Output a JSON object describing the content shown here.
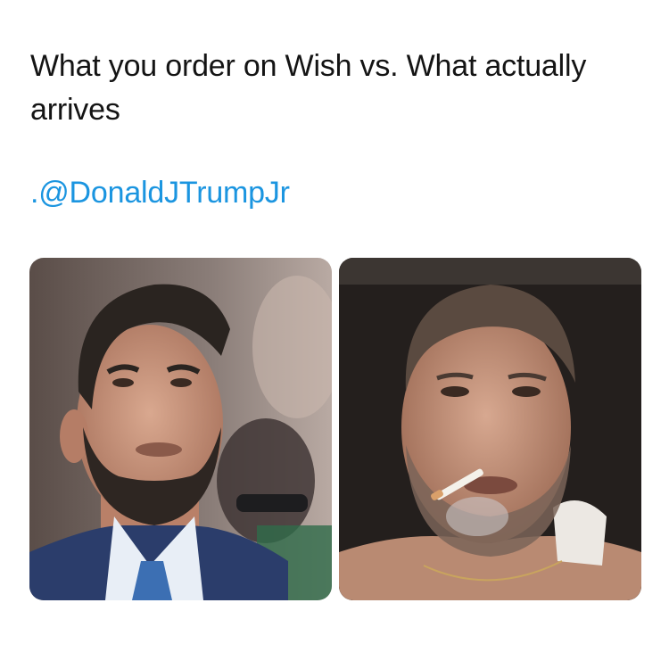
{
  "post": {
    "text": "What you order on Wish vs. What actually arrives",
    "mention": ".@DonaldJTrumpJr"
  },
  "images": [
    {
      "name": "left-photo",
      "description": "portrait"
    },
    {
      "name": "right-photo",
      "description": "selfie"
    }
  ],
  "colors": {
    "text": "#141414",
    "mention": "#1b95e0",
    "background": "#ffffff"
  }
}
